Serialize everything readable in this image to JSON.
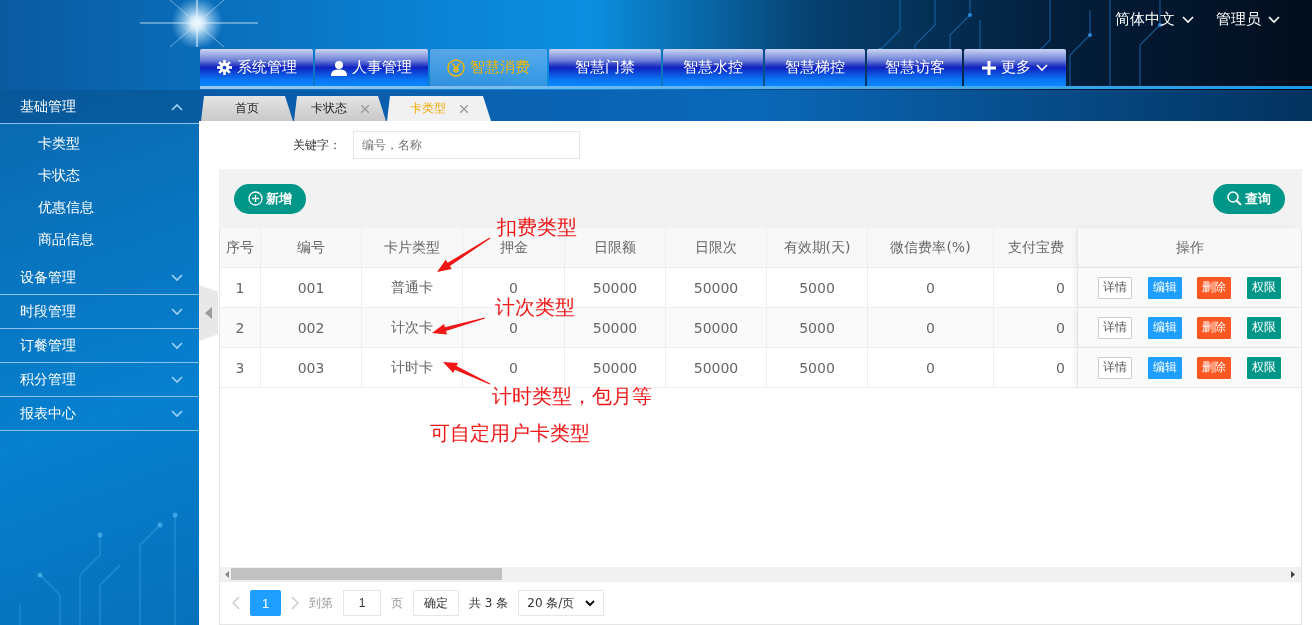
{
  "header": {
    "language": "简体中文",
    "user": "管理员"
  },
  "nav": [
    {
      "label": "系统管理",
      "kind": "settings",
      "selected": false
    },
    {
      "label": "人事管理",
      "kind": "user",
      "selected": false
    },
    {
      "label": "智慧消费",
      "kind": "currency",
      "selected": true
    },
    {
      "label": "智慧门禁",
      "kind": "plain",
      "selected": false
    },
    {
      "label": "智慧水控",
      "kind": "plain",
      "selected": false
    },
    {
      "label": "智慧梯控",
      "kind": "plain",
      "selected": false
    },
    {
      "label": "智慧访客",
      "kind": "plain",
      "selected": false
    },
    {
      "label": "更多",
      "kind": "more",
      "selected": false
    }
  ],
  "sidebar": [
    {
      "label": "基础管理",
      "expanded": true,
      "children": [
        {
          "label": "卡类型"
        },
        {
          "label": "卡状态"
        },
        {
          "label": "优惠信息"
        },
        {
          "label": "商品信息"
        }
      ]
    },
    {
      "label": "设备管理",
      "expanded": false
    },
    {
      "label": "时段管理",
      "expanded": false
    },
    {
      "label": "订餐管理",
      "expanded": false
    },
    {
      "label": "积分管理",
      "expanded": false
    },
    {
      "label": "报表中心",
      "expanded": false
    }
  ],
  "tabs": [
    {
      "label": "首页",
      "selected": false,
      "closable": false
    },
    {
      "label": "卡状态",
      "selected": false,
      "closable": true
    },
    {
      "label": "卡类型",
      "selected": true,
      "closable": true
    }
  ],
  "search": {
    "label": "关键字：",
    "placeholder": "编号，名称"
  },
  "toolbar": {
    "add": "新增",
    "query": "查询"
  },
  "table": {
    "columns": [
      "序号",
      "编号",
      "卡片类型",
      "押金",
      "日限额",
      "日限次",
      "有效期(天)",
      "微信费率(%)",
      "支付宝费",
      "操作"
    ],
    "rows": [
      {
        "cells": [
          "1",
          "001",
          "普通卡",
          "0",
          "50000",
          "50000",
          "5000",
          "0",
          "0"
        ],
        "actions": [
          {
            "label": "详情",
            "kind": "outline"
          },
          {
            "label": "编辑",
            "kind": "primary"
          },
          {
            "label": "删除",
            "kind": "danger"
          },
          {
            "label": "权限",
            "kind": "success"
          }
        ]
      },
      {
        "cells": [
          "2",
          "002",
          "计次卡",
          "0",
          "50000",
          "50000",
          "5000",
          "0",
          "0"
        ],
        "actions": [
          {
            "label": "详情",
            "kind": "outline"
          },
          {
            "label": "编辑",
            "kind": "primary"
          },
          {
            "label": "删除",
            "kind": "danger"
          },
          {
            "label": "权限",
            "kind": "success"
          }
        ]
      },
      {
        "cells": [
          "3",
          "003",
          "计时卡",
          "0",
          "50000",
          "50000",
          "5000",
          "0",
          "0"
        ],
        "actions": [
          {
            "label": "详情",
            "kind": "outline"
          },
          {
            "label": "编辑",
            "kind": "primary"
          },
          {
            "label": "删除",
            "kind": "danger"
          },
          {
            "label": "权限",
            "kind": "success"
          }
        ]
      }
    ]
  },
  "annotations": [
    {
      "text": "扣费类型",
      "arrow": true
    },
    {
      "text": "计次类型",
      "arrow": true
    },
    {
      "text": "计时类型，包月等",
      "arrow": true
    },
    {
      "text": "可自定用户卡类型",
      "arrow": false
    }
  ],
  "pagination": {
    "current": "1",
    "goto_label": "到第",
    "page_value": "1",
    "page_unit": "页",
    "confirm": "确定",
    "total": "共 3 条",
    "page_size": "20 条/页"
  }
}
